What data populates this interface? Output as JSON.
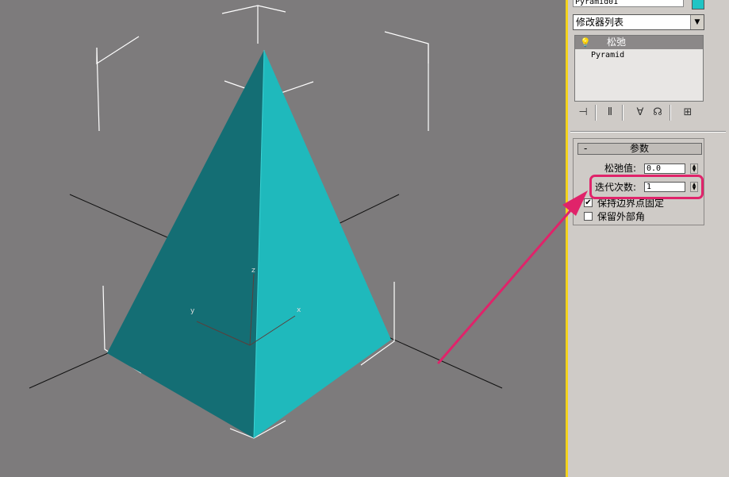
{
  "panel": {
    "object_name": "Pyramid01",
    "object_color": "#20c4c4",
    "modifier_list": "修改器列表",
    "stack": {
      "selected": "松弛",
      "base": "Pyramid"
    },
    "toolbar_icons": [
      "pin-stack-icon",
      "show-end-result-icon",
      "make-unique-icon",
      "remove-modifier-icon",
      "configure-modifier-sets-icon"
    ]
  },
  "rollout": {
    "collapse": "-",
    "title": "参数",
    "relax_value_label": "松弛值:",
    "relax_value": "0.0",
    "iterations_label": "迭代次数:",
    "iterations": "1",
    "keep_boundary_label": "保持边界点固定",
    "keep_boundary_checked": "✔",
    "save_outer_corners_label": "保留外部角",
    "save_outer_corners_checked": ""
  },
  "viewport": {
    "axis_x": "x",
    "axis_y": "y",
    "axis_z": "z",
    "object_color": "#1fb9bc",
    "object_shadow": "#146e74"
  },
  "annotation": {
    "highlight_color": "#e0236a"
  }
}
